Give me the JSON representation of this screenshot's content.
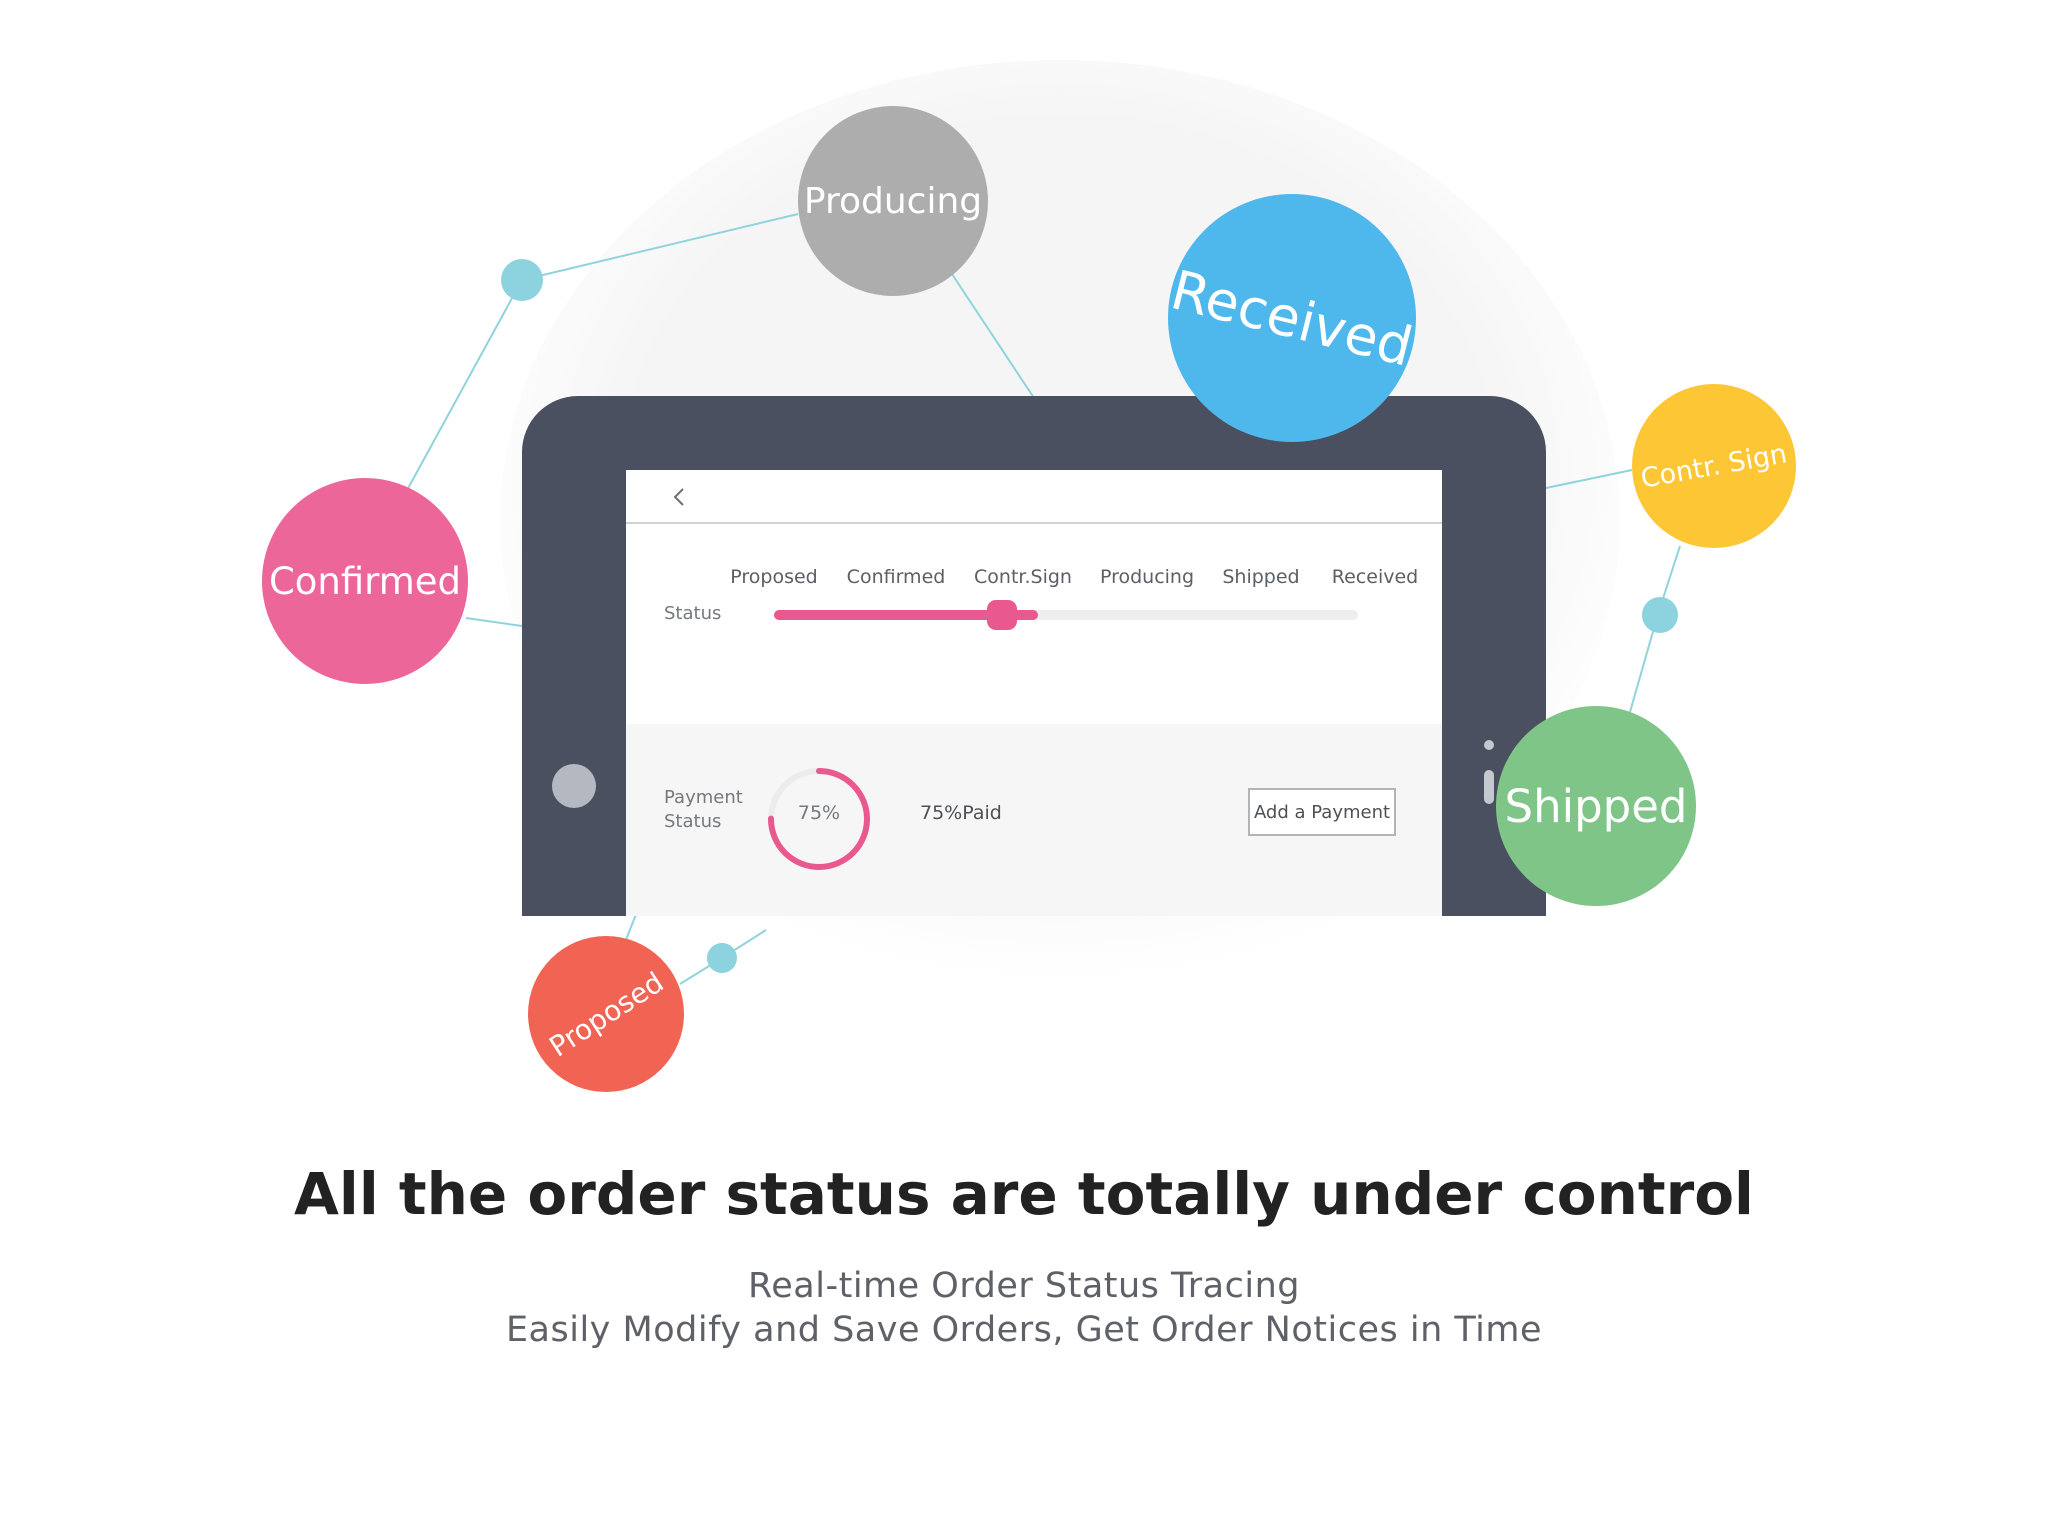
{
  "colors": {
    "tablet_frame": "#4a505f",
    "accent_pink": "#e9598f",
    "connector_line": "#8fd3dd",
    "connector_dot": "#8cd3df"
  },
  "bubbles": {
    "producing": {
      "label": "Producing",
      "color": "#adadad"
    },
    "received": {
      "label": "Received",
      "color": "#4eb8ec"
    },
    "contr_sign": {
      "label": "Contr. Sign",
      "color": "#fcc634"
    },
    "confirmed": {
      "label": "Confirmed",
      "color": "#ec6699"
    },
    "shipped": {
      "label": "Shipped",
      "color": "#80c588"
    },
    "proposed": {
      "label": "Proposed",
      "color": "#f16453"
    }
  },
  "app": {
    "back_icon": "chevron-left-icon",
    "status": {
      "label": "Status",
      "stages": [
        "Proposed",
        "Confirmed",
        "Contr.Sign",
        "Producing",
        "Shipped",
        "Received"
      ],
      "current_stage": "Contr.Sign",
      "progress_fraction": 0.39
    },
    "payment": {
      "label_line1": "Payment",
      "label_line2": "Status",
      "percent_text": "75%",
      "paid_fraction": 0.75,
      "paid_text": "75%Paid",
      "add_button": "Add a Payment"
    }
  },
  "headline": "All the order status are totally under control",
  "subtitle": {
    "line1": "Real-time Order Status Tracing",
    "line2": "Easily Modify and Save Orders, Get Order Notices in Time"
  }
}
